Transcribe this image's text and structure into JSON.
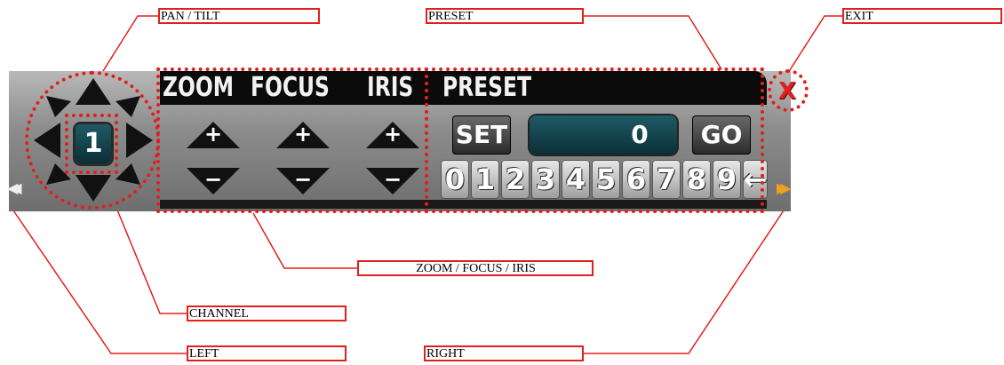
{
  "callouts": {
    "pan_tilt": "PAN / TILT",
    "preset": "PRESET",
    "exit": "EXIT",
    "zoom_focus_iris": "ZOOM / FOCUS / IRIS",
    "channel": "CHANNEL",
    "left": "LEFT",
    "right": "RIGHT"
  },
  "panel": {
    "headers": {
      "zoom": "ZOOM",
      "focus": "FOCUS",
      "iris": "IRIS",
      "preset": "PRESET"
    },
    "channel_value": "1",
    "plus_symbol": "+",
    "minus_symbol": "−",
    "preset": {
      "set_label": "SET",
      "go_label": "GO",
      "display_value": "0",
      "keys": [
        "0",
        "1",
        "2",
        "3",
        "4",
        "5",
        "6",
        "7",
        "8",
        "9"
      ],
      "backspace_symbol": "←"
    },
    "exit_symbol": "X",
    "left_symbol": "◀◀",
    "right_symbol": "▶▶"
  },
  "colors": {
    "callout_border": "#e0201c",
    "accent_orange": "#f0a020",
    "exit_red": "#e02020"
  }
}
